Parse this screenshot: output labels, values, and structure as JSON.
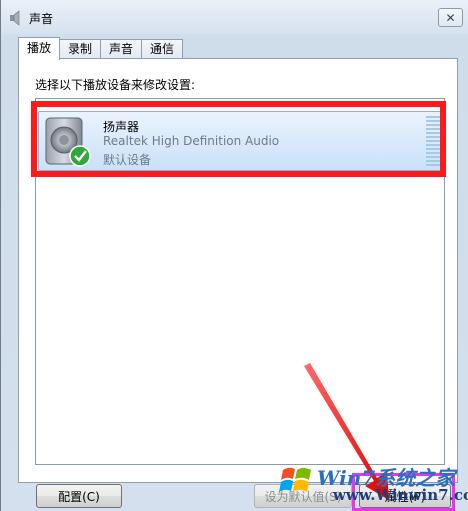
{
  "window": {
    "title": "声音",
    "close_label": "✕"
  },
  "tabs": [
    {
      "label": "播放",
      "active": true
    },
    {
      "label": "录制",
      "active": false
    },
    {
      "label": "声音",
      "active": false
    },
    {
      "label": "通信",
      "active": false
    }
  ],
  "playback": {
    "instruction": "选择以下播放设备来修改设置:",
    "devices": [
      {
        "name": "扬声器",
        "description": "Realtek High Definition Audio",
        "status": "默认设备",
        "icon": "speaker-icon",
        "badge": "green-check-icon"
      }
    ]
  },
  "buttons": {
    "configure": "配置(C)",
    "set_default": "设为默认值(S)",
    "properties": "属性(P)"
  },
  "watermark": {
    "line1": "Win7系统之家",
    "line2": "www.Winwin7.com"
  },
  "colors": {
    "highlight_red": "#ff1a1a",
    "highlight_magenta": "#ee33ee",
    "selection": "#c9e1fa"
  }
}
